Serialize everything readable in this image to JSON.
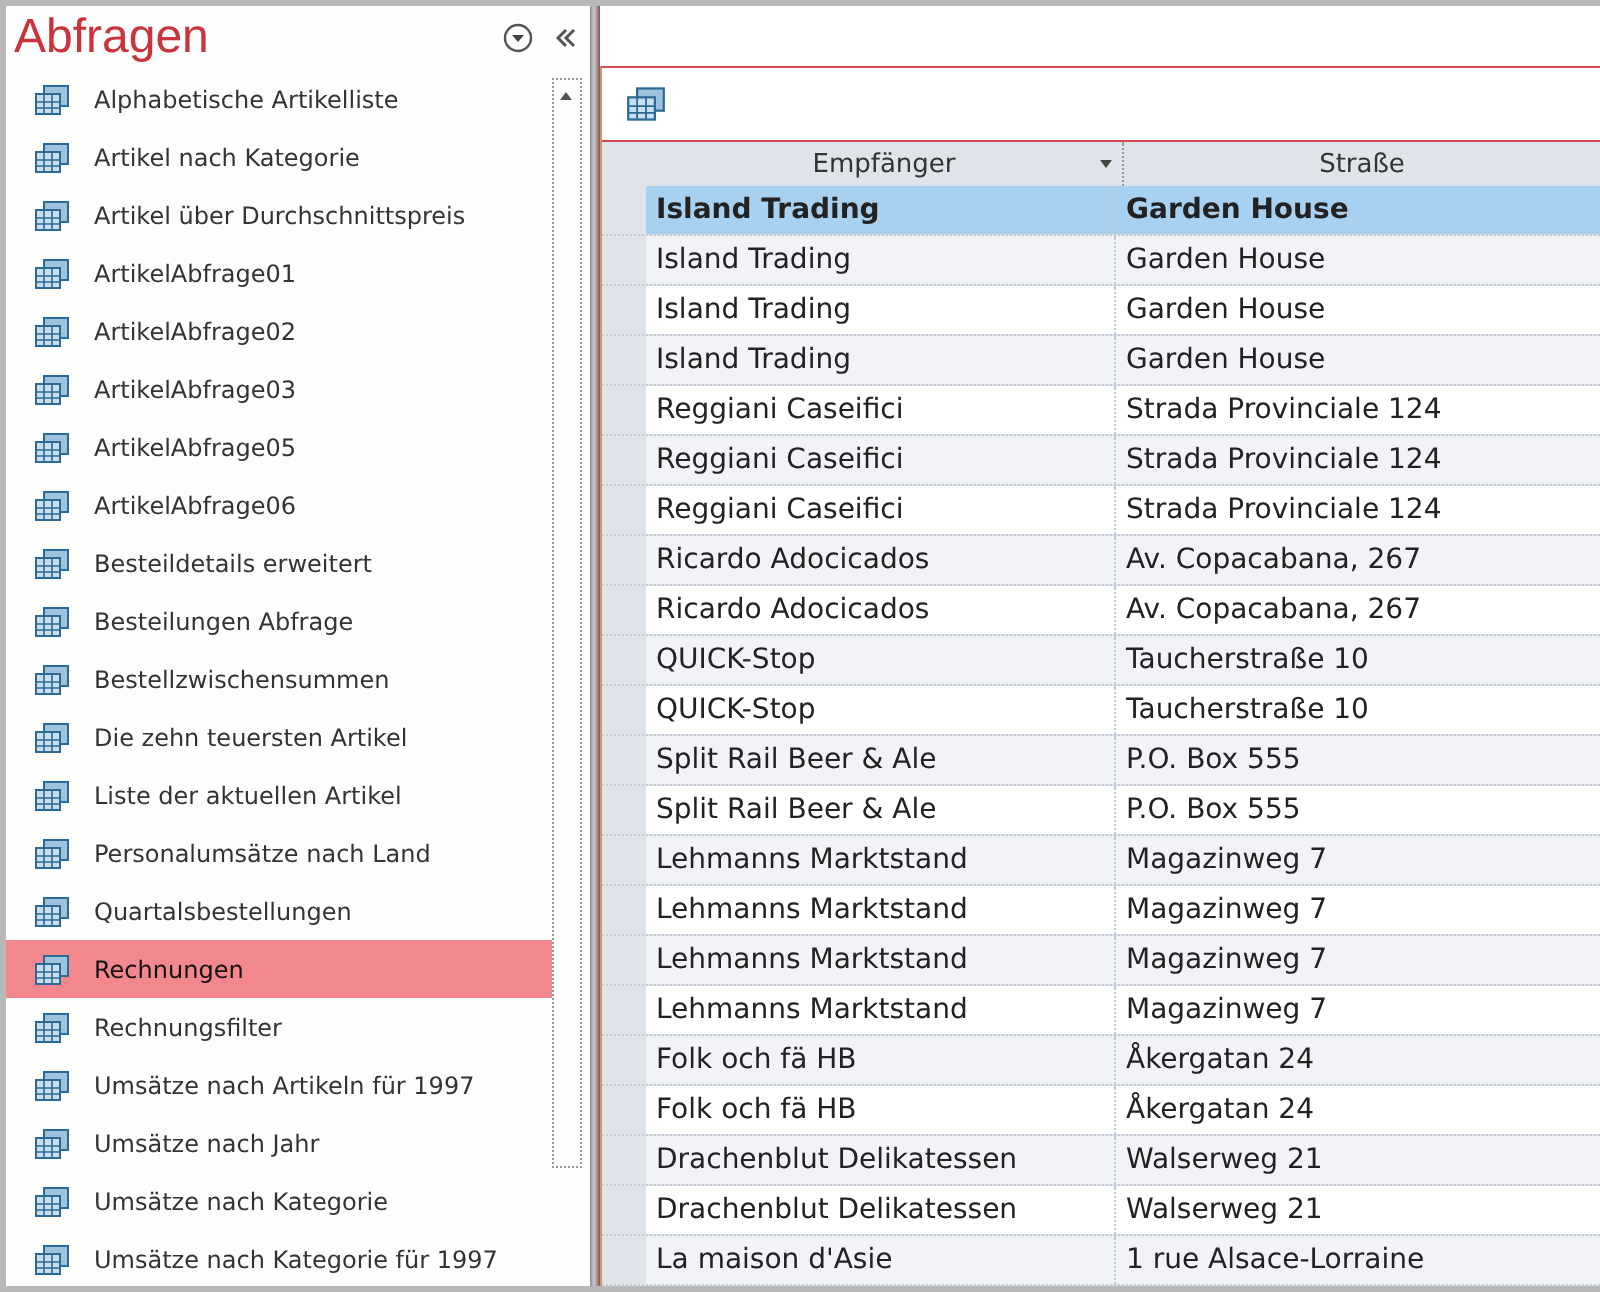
{
  "nav": {
    "title": "Abfragen",
    "items": [
      {
        "label": "Alphabetische Artikelliste",
        "selected": false
      },
      {
        "label": "Artikel nach Kategorie",
        "selected": false
      },
      {
        "label": "Artikel über Durchschnittspreis",
        "selected": false
      },
      {
        "label": "ArtikelAbfrage01",
        "selected": false
      },
      {
        "label": "ArtikelAbfrage02",
        "selected": false
      },
      {
        "label": "ArtikelAbfrage03",
        "selected": false
      },
      {
        "label": "ArtikelAbfrage05",
        "selected": false
      },
      {
        "label": "ArtikelAbfrage06",
        "selected": false
      },
      {
        "label": "Besteildetails erweitert",
        "selected": false
      },
      {
        "label": "Besteilungen Abfrage",
        "selected": false
      },
      {
        "label": "Bestellzwischensummen",
        "selected": false
      },
      {
        "label": "Die zehn teuersten Artikel",
        "selected": false
      },
      {
        "label": "Liste der aktuellen Artikel",
        "selected": false
      },
      {
        "label": "Personalumsätze nach Land",
        "selected": false
      },
      {
        "label": "Quartalsbestellungen",
        "selected": false
      },
      {
        "label": "Rechnungen",
        "selected": true
      },
      {
        "label": "Rechnungsfilter",
        "selected": false
      },
      {
        "label": "Umsätze nach Artikeln für 1997",
        "selected": false
      },
      {
        "label": "Umsätze nach Jahr",
        "selected": false
      },
      {
        "label": "Umsätze nach Kategorie",
        "selected": false
      },
      {
        "label": "Umsätze nach Kategorie für 1997",
        "selected": false
      }
    ]
  },
  "table": {
    "columns": [
      "Empfänger",
      "Straße"
    ],
    "rows": [
      {
        "cells": [
          "Island Trading",
          "Garden House"
        ],
        "selected": true
      },
      {
        "cells": [
          "Island Trading",
          "Garden House"
        ],
        "selected": false
      },
      {
        "cells": [
          "Island Trading",
          "Garden House"
        ],
        "selected": false
      },
      {
        "cells": [
          "Island Trading",
          "Garden House"
        ],
        "selected": false
      },
      {
        "cells": [
          "Reggiani Caseifici",
          "Strada Provinciale 124"
        ],
        "selected": false
      },
      {
        "cells": [
          "Reggiani Caseifici",
          "Strada Provinciale 124"
        ],
        "selected": false
      },
      {
        "cells": [
          "Reggiani Caseifici",
          "Strada Provinciale 124"
        ],
        "selected": false
      },
      {
        "cells": [
          "Ricardo Adocicados",
          "Av. Copacabana, 267"
        ],
        "selected": false
      },
      {
        "cells": [
          "Ricardo Adocicados",
          "Av. Copacabana, 267"
        ],
        "selected": false
      },
      {
        "cells": [
          "QUICK-Stop",
          "Taucherstraße 10"
        ],
        "selected": false
      },
      {
        "cells": [
          "QUICK-Stop",
          "Taucherstraße 10"
        ],
        "selected": false
      },
      {
        "cells": [
          "Split Rail Beer & Ale",
          "P.O. Box 555"
        ],
        "selected": false
      },
      {
        "cells": [
          "Split Rail Beer & Ale",
          "P.O. Box 555"
        ],
        "selected": false
      },
      {
        "cells": [
          "Lehmanns Marktstand",
          "Magazinweg 7"
        ],
        "selected": false
      },
      {
        "cells": [
          "Lehmanns Marktstand",
          "Magazinweg 7"
        ],
        "selected": false
      },
      {
        "cells": [
          "Lehmanns Marktstand",
          "Magazinweg 7"
        ],
        "selected": false
      },
      {
        "cells": [
          "Lehmanns Marktstand",
          "Magazinweg 7"
        ],
        "selected": false
      },
      {
        "cells": [
          "Folk och fä HB",
          "Åkergatan 24"
        ],
        "selected": false
      },
      {
        "cells": [
          "Folk och fä HB",
          "Åkergatan 24"
        ],
        "selected": false
      },
      {
        "cells": [
          "Drachenblut Delikatessen",
          "Walserweg 21"
        ],
        "selected": false
      },
      {
        "cells": [
          "Drachenblut Delikatessen",
          "Walserweg 21"
        ],
        "selected": false
      },
      {
        "cells": [
          "La maison d'Asie",
          "1 rue Alsace-Lorraine"
        ],
        "selected": false
      }
    ]
  }
}
